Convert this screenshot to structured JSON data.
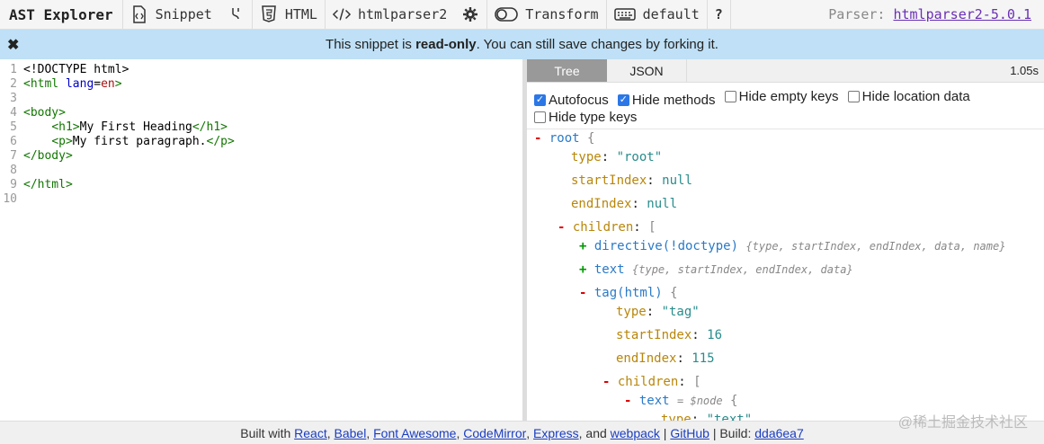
{
  "toolbar": {
    "title": "AST Explorer",
    "snippet_label": "Snippet",
    "language_label": "HTML",
    "parser_name": "htmlparser2",
    "transform_label": "Transform",
    "keymap_label": "default",
    "help_label": "?",
    "parser_prefix": "Parser:",
    "parser_version": "htmlparser2-5.0.1"
  },
  "banner": {
    "close": "✖",
    "text_before": "This snippet is ",
    "text_bold": "read-only",
    "text_after": ". You can still save changes by forking it."
  },
  "editor": {
    "line_numbers": [
      "1",
      "2",
      "3",
      "4",
      "5",
      "6",
      "7",
      "8",
      "9",
      "10"
    ]
  },
  "panel": {
    "tab_tree": "Tree",
    "tab_json": "JSON",
    "timing": "1.05s",
    "options": {
      "autofocus": "Autofocus",
      "hide_methods": "Hide methods",
      "hide_empty_keys": "Hide empty keys",
      "hide_location": "Hide location data",
      "hide_type_keys": "Hide type keys"
    }
  },
  "tree": {
    "root": "root",
    "type_key": "type",
    "type_root": "\"root\"",
    "start_key": "startIndex",
    "end_key": "endIndex",
    "null": "null",
    "children": "children",
    "directive": "directive(!doctype)",
    "directive_summary": "{type, startIndex, endIndex, data, name}",
    "text_node": "text",
    "text_summary": "{type, startIndex, endIndex, data}",
    "tag_html": "tag(html)",
    "type_tag": "\"tag\"",
    "start_val": "16",
    "end_val": "115",
    "node_ref": "= $node",
    "type_text": "\"text\""
  },
  "footer": {
    "built_with": "Built with",
    "react": "React",
    "babel": "Babel",
    "fontawesome": "Font Awesome",
    "codemirror": "CodeMirror",
    "express": "Express",
    "and": ", and",
    "webpack": "webpack",
    "github": "GitHub",
    "build_label": "| Build:",
    "build_hash": "dda6ea7"
  },
  "watermark": "@稀土掘金技术社区"
}
